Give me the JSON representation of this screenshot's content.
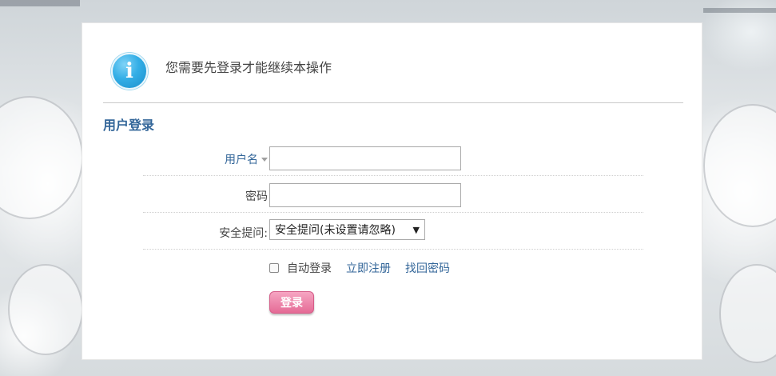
{
  "alert": {
    "icon": "info-icon",
    "icon_glyph": "i",
    "message": "您需要先登录才能继续本操作"
  },
  "section": {
    "title": "用户登录"
  },
  "form": {
    "username": {
      "label": "用户名",
      "value": ""
    },
    "password": {
      "label": "密码",
      "value": ""
    },
    "security_question": {
      "label": "安全提问:",
      "selected": "安全提问(未设置请忽略)",
      "arrow": "▼"
    }
  },
  "options": {
    "auto_login_label": "自动登录",
    "auto_login_checked": false,
    "register_link": "立即注册",
    "recover_link": "找回密码"
  },
  "submit": {
    "label": "登录"
  },
  "colors": {
    "accent": "#336699",
    "button": "#e56b96",
    "info_icon": "#33aee6"
  }
}
